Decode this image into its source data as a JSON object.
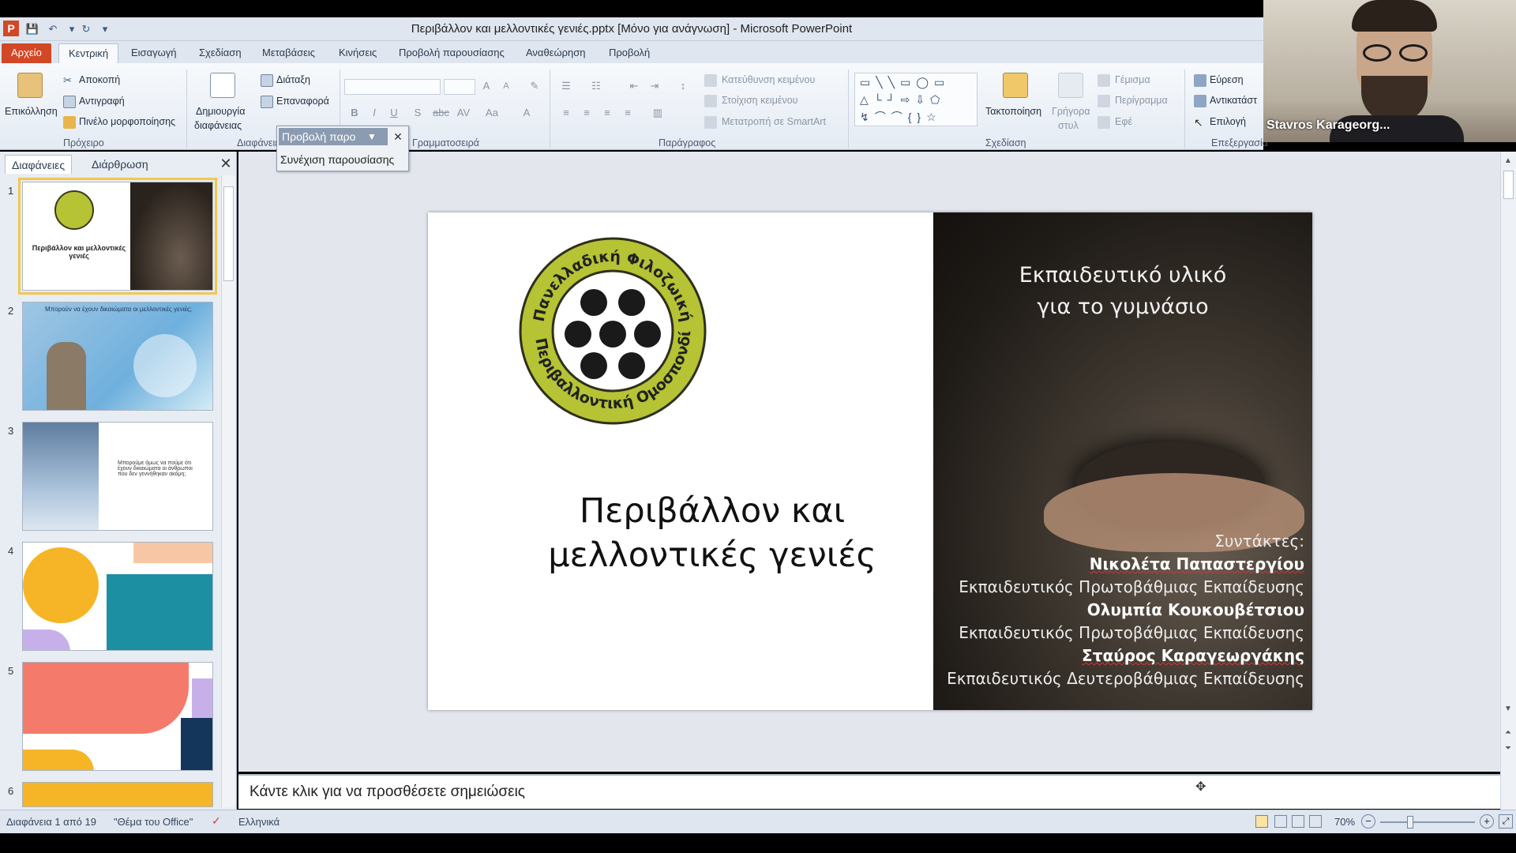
{
  "window": {
    "title": "Περιβάλλον και μελλοντικές γενιές.pptx [Μόνο για ανάγνωση] - Microsoft PowerPoint",
    "app_icon": "P"
  },
  "ribbon_tabs": [
    "Αρχείο",
    "Κεντρική",
    "Εισαγωγή",
    "Σχεδίαση",
    "Μεταβάσεις",
    "Κινήσεις",
    "Προβολή παρουσίασης",
    "Αναθεώρηση",
    "Προβολή"
  ],
  "ribbon": {
    "clipboard": {
      "paste": "Επικόλληση",
      "cut": "Αποκοπή",
      "copy": "Αντιγραφή",
      "format_painter": "Πινέλο μορφοποίησης",
      "group": "Πρόχειρο"
    },
    "slides": {
      "new_slide_1": "Δημιουργία",
      "new_slide_2": "διαφάνειας",
      "layout": "Διάταξη",
      "reset": "Επαναφορά",
      "group": "Διαφάνειες"
    },
    "font": {
      "group": "Γραμματοσειρά"
    },
    "paragraph": {
      "text_direction": "Κατεύθυνση κειμένου",
      "align_text": "Στοίχιση κειμένου",
      "smartart": "Μετατροπή σε SmartArt",
      "group": "Παράγραφος"
    },
    "drawing": {
      "arrange": "Τακτοποίηση",
      "quick_styles_1": "Γρήγορα",
      "quick_styles_2": "στυλ",
      "fill": "Γέμισμα",
      "outline": "Περίγραμμα",
      "effects": "Εφέ",
      "group": "Σχεδίαση"
    },
    "editing": {
      "find": "Εύρεση",
      "replace": "Αντικατάστ",
      "select": "Επιλογή",
      "group": "Επεξεργασία"
    }
  },
  "popup": {
    "title": "Προβολή παρο",
    "item": "Συνέχιση παρουσίασης"
  },
  "left_panel": {
    "tabs": [
      "Διαφάνειες",
      "Διάρθρωση"
    ],
    "thumbs": [
      {
        "num": "1",
        "title": "Περιβάλλον και μελλοντικές γενιές"
      },
      {
        "num": "2",
        "title": "Μπορούν να έχουν δικαιώματα οι μελλοντικές γενιές;"
      },
      {
        "num": "3",
        "title": "Μπορούμε όμως να πούμε ότι έχουν δικαιώματα οι άνθρωποι που δεν γεννήθηκαν ακόμη;"
      },
      {
        "num": "4",
        "title": ""
      },
      {
        "num": "5",
        "title": ""
      },
      {
        "num": "6",
        "title": ""
      }
    ]
  },
  "slide": {
    "title_line1": "Περιβάλλον και",
    "title_line2": "μελλοντικές γενιές",
    "subtitle_line1": "Εκπαιδευτικό υλικό",
    "subtitle_line2": "για το γυμνάσιο",
    "authors_label": "Συντάκτες:",
    "authors": [
      {
        "name": "Νικολέτα Παπαστεργίου",
        "role": "Εκπαιδευτικός Πρωτοβάθμιας Εκπαίδευσης"
      },
      {
        "name": "Ολυμπία Κουκουβέτσιου",
        "role": "Εκπαιδευτικός Πρωτοβάθμιας Εκπαίδευσης"
      },
      {
        "name": "Σταύρος Καραγεωργάκης",
        "role": "Εκπαιδευτικός Δευτεροβάθμιας Εκπαίδευσης"
      }
    ],
    "logo_top": "Πανελλαδική Φιλοζωική",
    "logo_bottom": "& Περιβαλλοντική Ομοσπονδία"
  },
  "notes": {
    "placeholder": "Κάντε κλικ για να προσθέσετε σημειώσεις"
  },
  "status": {
    "slide_count": "Διαφάνεια 1 από 19",
    "theme": "\"Θέμα του Office\"",
    "language": "Ελληνικά",
    "zoom": "70%"
  },
  "webcam": {
    "name": "Stavros Karageorg..."
  },
  "colors": {
    "accent": "#d24726",
    "logo_green": "#b5c334",
    "title_bar": "#dfe6ef"
  }
}
